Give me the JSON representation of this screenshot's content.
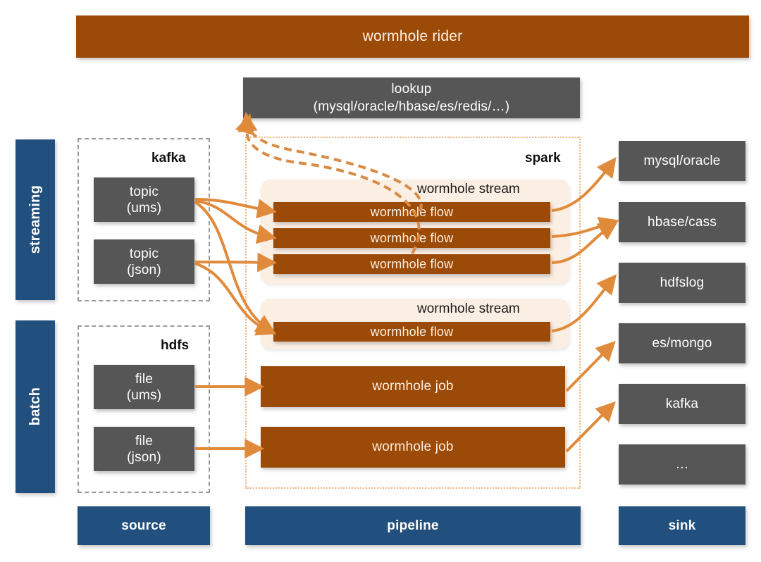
{
  "diagram": {
    "title": "wormhole rider",
    "header": {
      "rider_label": "wormhole rider"
    },
    "lookup": {
      "line1": "lookup",
      "line2": "(mysql/oracle/hbase/es/redis/…)"
    },
    "lanes": [
      {
        "id": "streaming",
        "label": "streaming"
      },
      {
        "id": "batch",
        "label": "batch"
      }
    ],
    "source_groups": [
      {
        "id": "kafka",
        "label": "kafka",
        "items": [
          {
            "line1": "topic",
            "line2": "(ums)"
          },
          {
            "line1": "topic",
            "line2": "(json)"
          }
        ]
      },
      {
        "id": "hdfs",
        "label": "hdfs",
        "items": [
          {
            "line1": "file",
            "line2": "(ums)"
          },
          {
            "line1": "file",
            "line2": "(json)"
          }
        ]
      }
    ],
    "pipeline": {
      "label": "spark",
      "streams": [
        {
          "title": "wormhole stream",
          "flows": [
            {
              "label": "wormhole flow"
            },
            {
              "label": "wormhole flow"
            },
            {
              "label": "wormhole flow"
            }
          ]
        },
        {
          "title": "wormhole stream",
          "flows": [
            {
              "label": "wormhole flow"
            }
          ]
        }
      ],
      "jobs": [
        {
          "label": "wormhole job"
        },
        {
          "label": "wormhole job"
        }
      ]
    },
    "sinks": [
      {
        "label": "mysql/oracle"
      },
      {
        "label": "hbase/cass"
      },
      {
        "label": "hdfslog"
      },
      {
        "label": "es/mongo"
      },
      {
        "label": "kafka"
      },
      {
        "label": "…"
      }
    ],
    "footer": [
      {
        "id": "source",
        "label": "source"
      },
      {
        "id": "pipeline",
        "label": "pipeline"
      },
      {
        "id": "sink",
        "label": "sink"
      }
    ],
    "colors": {
      "brown": "#9c4a08",
      "navy": "#22507e",
      "gray": "#565656",
      "orange_arrow": "#e08b3c",
      "stream_tint": "#fbeee3",
      "group_dash": "#9a9a9a",
      "spark_dotted": "#f0b278"
    }
  }
}
